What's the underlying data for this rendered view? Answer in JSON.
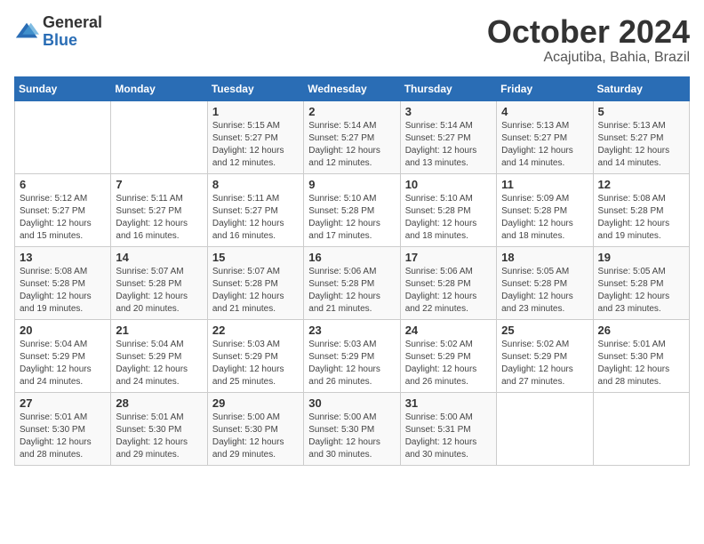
{
  "header": {
    "logo": {
      "general": "General",
      "blue": "Blue"
    },
    "title": "October 2024",
    "subtitle": "Acajutiba, Bahia, Brazil"
  },
  "calendar": {
    "weekdays": [
      "Sunday",
      "Monday",
      "Tuesday",
      "Wednesday",
      "Thursday",
      "Friday",
      "Saturday"
    ],
    "weeks": [
      [
        {
          "day": "",
          "sunrise": "",
          "sunset": "",
          "daylight": ""
        },
        {
          "day": "",
          "sunrise": "",
          "sunset": "",
          "daylight": ""
        },
        {
          "day": "1",
          "sunrise": "Sunrise: 5:15 AM",
          "sunset": "Sunset: 5:27 PM",
          "daylight": "Daylight: 12 hours and 12 minutes."
        },
        {
          "day": "2",
          "sunrise": "Sunrise: 5:14 AM",
          "sunset": "Sunset: 5:27 PM",
          "daylight": "Daylight: 12 hours and 12 minutes."
        },
        {
          "day": "3",
          "sunrise": "Sunrise: 5:14 AM",
          "sunset": "Sunset: 5:27 PM",
          "daylight": "Daylight: 12 hours and 13 minutes."
        },
        {
          "day": "4",
          "sunrise": "Sunrise: 5:13 AM",
          "sunset": "Sunset: 5:27 PM",
          "daylight": "Daylight: 12 hours and 14 minutes."
        },
        {
          "day": "5",
          "sunrise": "Sunrise: 5:13 AM",
          "sunset": "Sunset: 5:27 PM",
          "daylight": "Daylight: 12 hours and 14 minutes."
        }
      ],
      [
        {
          "day": "6",
          "sunrise": "Sunrise: 5:12 AM",
          "sunset": "Sunset: 5:27 PM",
          "daylight": "Daylight: 12 hours and 15 minutes."
        },
        {
          "day": "7",
          "sunrise": "Sunrise: 5:11 AM",
          "sunset": "Sunset: 5:27 PM",
          "daylight": "Daylight: 12 hours and 16 minutes."
        },
        {
          "day": "8",
          "sunrise": "Sunrise: 5:11 AM",
          "sunset": "Sunset: 5:27 PM",
          "daylight": "Daylight: 12 hours and 16 minutes."
        },
        {
          "day": "9",
          "sunrise": "Sunrise: 5:10 AM",
          "sunset": "Sunset: 5:28 PM",
          "daylight": "Daylight: 12 hours and 17 minutes."
        },
        {
          "day": "10",
          "sunrise": "Sunrise: 5:10 AM",
          "sunset": "Sunset: 5:28 PM",
          "daylight": "Daylight: 12 hours and 18 minutes."
        },
        {
          "day": "11",
          "sunrise": "Sunrise: 5:09 AM",
          "sunset": "Sunset: 5:28 PM",
          "daylight": "Daylight: 12 hours and 18 minutes."
        },
        {
          "day": "12",
          "sunrise": "Sunrise: 5:08 AM",
          "sunset": "Sunset: 5:28 PM",
          "daylight": "Daylight: 12 hours and 19 minutes."
        }
      ],
      [
        {
          "day": "13",
          "sunrise": "Sunrise: 5:08 AM",
          "sunset": "Sunset: 5:28 PM",
          "daylight": "Daylight: 12 hours and 19 minutes."
        },
        {
          "day": "14",
          "sunrise": "Sunrise: 5:07 AM",
          "sunset": "Sunset: 5:28 PM",
          "daylight": "Daylight: 12 hours and 20 minutes."
        },
        {
          "day": "15",
          "sunrise": "Sunrise: 5:07 AM",
          "sunset": "Sunset: 5:28 PM",
          "daylight": "Daylight: 12 hours and 21 minutes."
        },
        {
          "day": "16",
          "sunrise": "Sunrise: 5:06 AM",
          "sunset": "Sunset: 5:28 PM",
          "daylight": "Daylight: 12 hours and 21 minutes."
        },
        {
          "day": "17",
          "sunrise": "Sunrise: 5:06 AM",
          "sunset": "Sunset: 5:28 PM",
          "daylight": "Daylight: 12 hours and 22 minutes."
        },
        {
          "day": "18",
          "sunrise": "Sunrise: 5:05 AM",
          "sunset": "Sunset: 5:28 PM",
          "daylight": "Daylight: 12 hours and 23 minutes."
        },
        {
          "day": "19",
          "sunrise": "Sunrise: 5:05 AM",
          "sunset": "Sunset: 5:28 PM",
          "daylight": "Daylight: 12 hours and 23 minutes."
        }
      ],
      [
        {
          "day": "20",
          "sunrise": "Sunrise: 5:04 AM",
          "sunset": "Sunset: 5:29 PM",
          "daylight": "Daylight: 12 hours and 24 minutes."
        },
        {
          "day": "21",
          "sunrise": "Sunrise: 5:04 AM",
          "sunset": "Sunset: 5:29 PM",
          "daylight": "Daylight: 12 hours and 24 minutes."
        },
        {
          "day": "22",
          "sunrise": "Sunrise: 5:03 AM",
          "sunset": "Sunset: 5:29 PM",
          "daylight": "Daylight: 12 hours and 25 minutes."
        },
        {
          "day": "23",
          "sunrise": "Sunrise: 5:03 AM",
          "sunset": "Sunset: 5:29 PM",
          "daylight": "Daylight: 12 hours and 26 minutes."
        },
        {
          "day": "24",
          "sunrise": "Sunrise: 5:02 AM",
          "sunset": "Sunset: 5:29 PM",
          "daylight": "Daylight: 12 hours and 26 minutes."
        },
        {
          "day": "25",
          "sunrise": "Sunrise: 5:02 AM",
          "sunset": "Sunset: 5:29 PM",
          "daylight": "Daylight: 12 hours and 27 minutes."
        },
        {
          "day": "26",
          "sunrise": "Sunrise: 5:01 AM",
          "sunset": "Sunset: 5:30 PM",
          "daylight": "Daylight: 12 hours and 28 minutes."
        }
      ],
      [
        {
          "day": "27",
          "sunrise": "Sunrise: 5:01 AM",
          "sunset": "Sunset: 5:30 PM",
          "daylight": "Daylight: 12 hours and 28 minutes."
        },
        {
          "day": "28",
          "sunrise": "Sunrise: 5:01 AM",
          "sunset": "Sunset: 5:30 PM",
          "daylight": "Daylight: 12 hours and 29 minutes."
        },
        {
          "day": "29",
          "sunrise": "Sunrise: 5:00 AM",
          "sunset": "Sunset: 5:30 PM",
          "daylight": "Daylight: 12 hours and 29 minutes."
        },
        {
          "day": "30",
          "sunrise": "Sunrise: 5:00 AM",
          "sunset": "Sunset: 5:30 PM",
          "daylight": "Daylight: 12 hours and 30 minutes."
        },
        {
          "day": "31",
          "sunrise": "Sunrise: 5:00 AM",
          "sunset": "Sunset: 5:31 PM",
          "daylight": "Daylight: 12 hours and 30 minutes."
        },
        {
          "day": "",
          "sunrise": "",
          "sunset": "",
          "daylight": ""
        },
        {
          "day": "",
          "sunrise": "",
          "sunset": "",
          "daylight": ""
        }
      ]
    ]
  }
}
